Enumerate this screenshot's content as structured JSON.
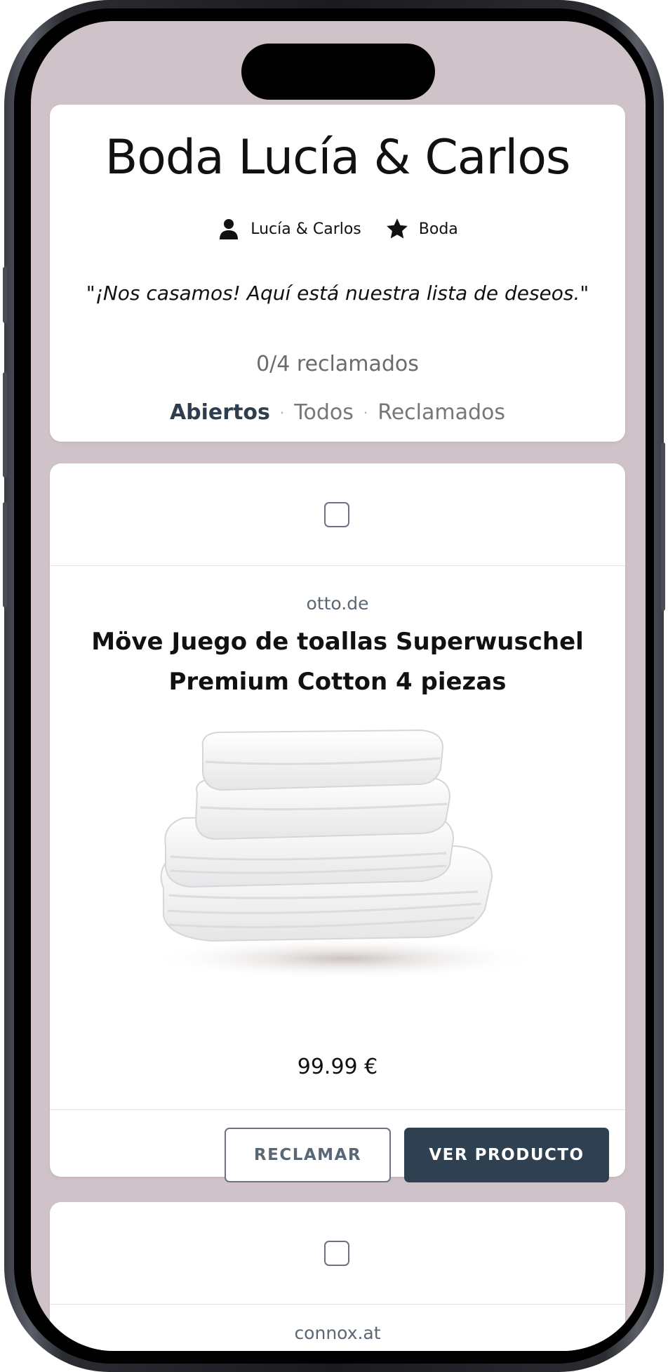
{
  "registry": {
    "title": "Boda Lucía & Carlos",
    "owner": "Lucía & Carlos",
    "category": "Boda",
    "quote": "\"¡Nos casamos! Aquí está nuestra lista de deseos.\"",
    "claimed_status": "0/4 reclamados",
    "filters": {
      "open": "Abiertos",
      "all": "Todos",
      "claimed": "Reclamados",
      "separator": "·"
    }
  },
  "items": [
    {
      "store": "otto.de",
      "title": "Möve Juego de toallas Superwuschel Premium Cotton 4 piezas",
      "price": "99.99 €",
      "claim_label": "RECLAMAR",
      "view_label": "VER PRODUCTO",
      "checked": false
    },
    {
      "store": "connox.at",
      "checked": false
    }
  ],
  "colors": {
    "background": "#cfc2c8",
    "accent": "#2f4051"
  },
  "icons": {
    "owner": "user-icon",
    "category": "star-icon"
  }
}
